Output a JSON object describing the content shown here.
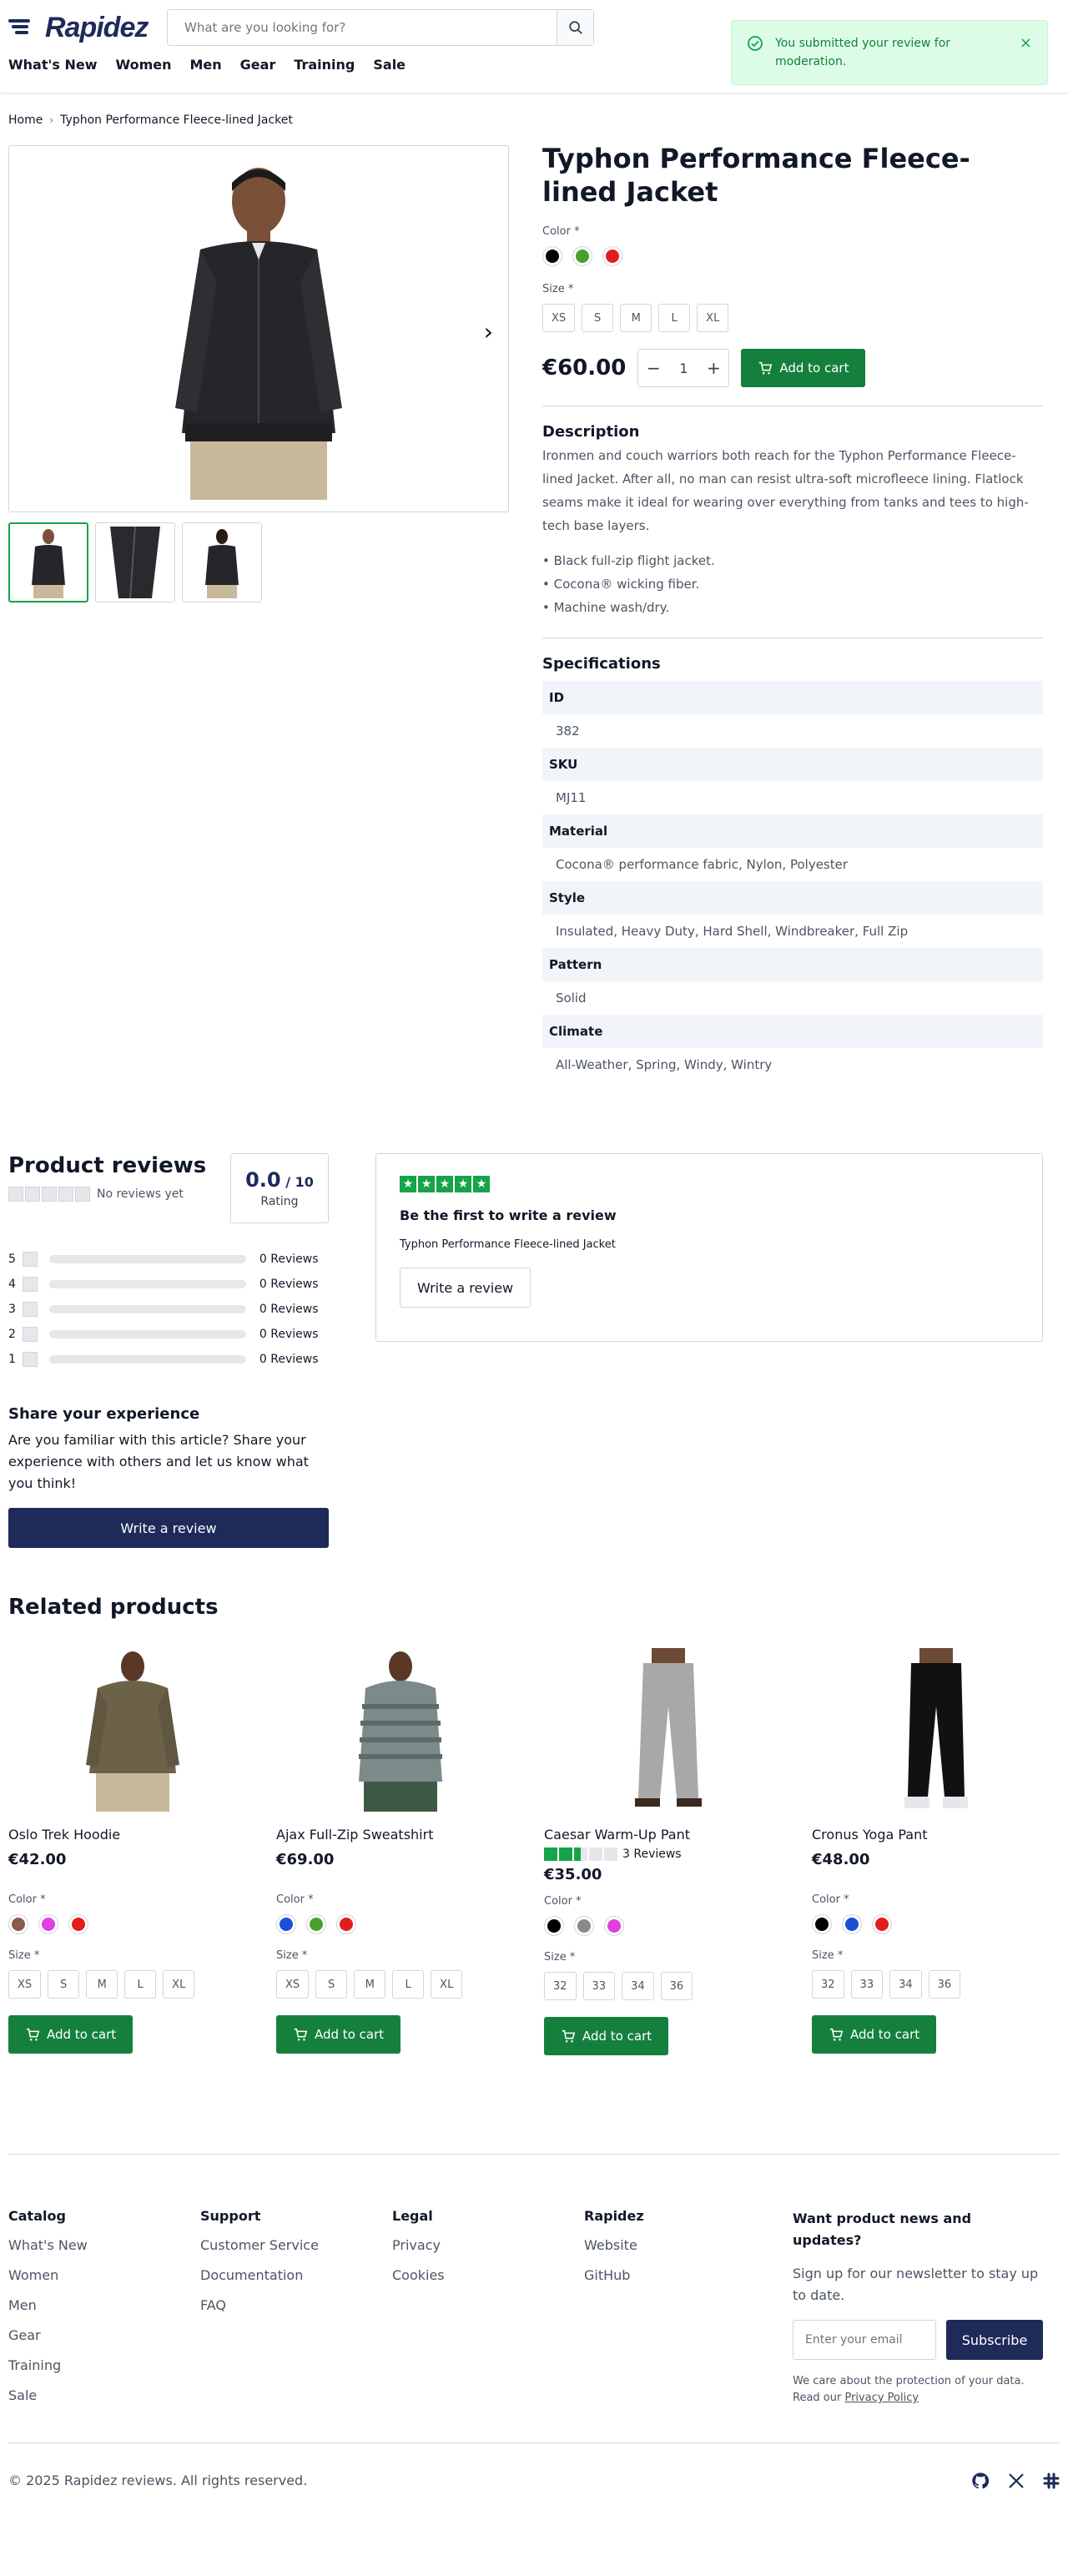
{
  "header": {
    "logo_text": "Rapidez",
    "search_placeholder": "What are you looking for?",
    "nav": [
      "What's New",
      "Women",
      "Men",
      "Gear",
      "Training",
      "Sale"
    ]
  },
  "toast": {
    "message": "You submitted your review for moderation.",
    "close": "×"
  },
  "breadcrumb": [
    "Home",
    "Typhon Performance Fleece-lined Jacket"
  ],
  "product": {
    "title": "Typhon Performance Fleece-lined Jacket",
    "color_label": "Color *",
    "colors": [
      "#000000",
      "#4aa02c",
      "#e11d1d"
    ],
    "size_label": "Size *",
    "sizes": [
      "XS",
      "S",
      "M",
      "L",
      "XL"
    ],
    "price": "€60.00",
    "qty": "1",
    "qty_minus": "−",
    "qty_plus": "+",
    "add_to_cart": "Add to cart",
    "description_heading": "Description",
    "description": "Ironmen and couch warriors both reach for the Typhon Performance Fleece-lined Jacket. After all, no man can resist ultra-soft microfleece lining. Flatlock seams make it ideal for wearing over everything from tanks and tees to high-tech base layers.",
    "bullets": [
      "• Black full-zip flight jacket.",
      "• Cocona® wicking fiber.",
      "• Machine wash/dry."
    ],
    "specs_heading": "Specifications",
    "specs": [
      {
        "key": "ID",
        "value": "382"
      },
      {
        "key": "SKU",
        "value": "MJ11"
      },
      {
        "key": "Material",
        "value": "Cocona® performance fabric, Nylon, Polyester"
      },
      {
        "key": "Style",
        "value": "Insulated, Heavy Duty, Hard Shell, Windbreaker, Full Zip"
      },
      {
        "key": "Pattern",
        "value": "Solid"
      },
      {
        "key": "Climate",
        "value": "All-Weather, Spring, Windy, Wintry"
      }
    ]
  },
  "reviews": {
    "title": "Product reviews",
    "no_reviews": "No reviews yet",
    "score": "0.0",
    "score_max": " / 10",
    "score_label": "Rating",
    "rows": [
      {
        "star": "5",
        "count": "0 Reviews"
      },
      {
        "star": "4",
        "count": "0 Reviews"
      },
      {
        "star": "3",
        "count": "0 Reviews"
      },
      {
        "star": "2",
        "count": "0 Reviews"
      },
      {
        "star": "1",
        "count": "0 Reviews"
      }
    ],
    "share_heading": "Share your experience",
    "share_text": "Are you familiar with this article? Share your experience with others and let us know what you think!",
    "write_review": "Write a review",
    "card_title": "Be the first to write a review",
    "card_product": "Typhon Performance Fleece-lined Jacket",
    "card_button": "Write a review"
  },
  "related": {
    "heading": "Related products",
    "items": [
      {
        "name": "Oslo Trek Hoodie",
        "price": "€42.00",
        "colors": [
          "#8b5a4a",
          "#e040e0",
          "#e11d1d"
        ],
        "sizes": [
          "XS",
          "S",
          "M",
          "L",
          "XL"
        ],
        "color_label": "Color *",
        "size_label": "Size *",
        "cart": "Add to cart"
      },
      {
        "name": "Ajax Full-Zip Sweatshirt",
        "price": "€69.00",
        "colors": [
          "#1d4ed8",
          "#4aa02c",
          "#e11d1d"
        ],
        "sizes": [
          "XS",
          "S",
          "M",
          "L",
          "XL"
        ],
        "color_label": "Color *",
        "size_label": "Size *",
        "cart": "Add to cart"
      },
      {
        "name": "Caesar Warm-Up Pant",
        "price": "€35.00",
        "rating_text": "3 Reviews",
        "rating_stars": 2.5,
        "colors": [
          "#000000",
          "#8a8a8a",
          "#e040e0"
        ],
        "sizes": [
          "32",
          "33",
          "34",
          "36"
        ],
        "color_label": "Color *",
        "size_label": "Size *",
        "cart": "Add to cart"
      },
      {
        "name": "Cronus Yoga Pant",
        "price": "€48.00",
        "colors": [
          "#000000",
          "#1d4ed8",
          "#e11d1d"
        ],
        "sizes": [
          "32",
          "33",
          "34",
          "36"
        ],
        "color_label": "Color *",
        "size_label": "Size *",
        "cart": "Add to cart"
      }
    ]
  },
  "footer": {
    "columns": [
      {
        "heading": "Catalog",
        "links": [
          "What's New",
          "Women",
          "Men",
          "Gear",
          "Training",
          "Sale"
        ]
      },
      {
        "heading": "Support",
        "links": [
          "Customer Service",
          "Documentation",
          "FAQ"
        ]
      },
      {
        "heading": "Legal",
        "links": [
          "Privacy",
          "Cookies"
        ]
      },
      {
        "heading": "Rapidez",
        "links": [
          "Website",
          "GitHub"
        ]
      }
    ],
    "newsletter_heading": "Want product news and updates?",
    "newsletter_text": "Sign up for our newsletter to stay up to date.",
    "newsletter_placeholder": "Enter your email",
    "subscribe": "Subscribe",
    "note_prefix": "We care about the protection of your data. Read our ",
    "note_link": "Privacy Policy",
    "copyright": "© 2025 Rapidez reviews. All rights reserved."
  },
  "colors": {
    "brand": "#1e2a5a",
    "accent": "#15803d",
    "toast_bg": "#dcfce7"
  }
}
